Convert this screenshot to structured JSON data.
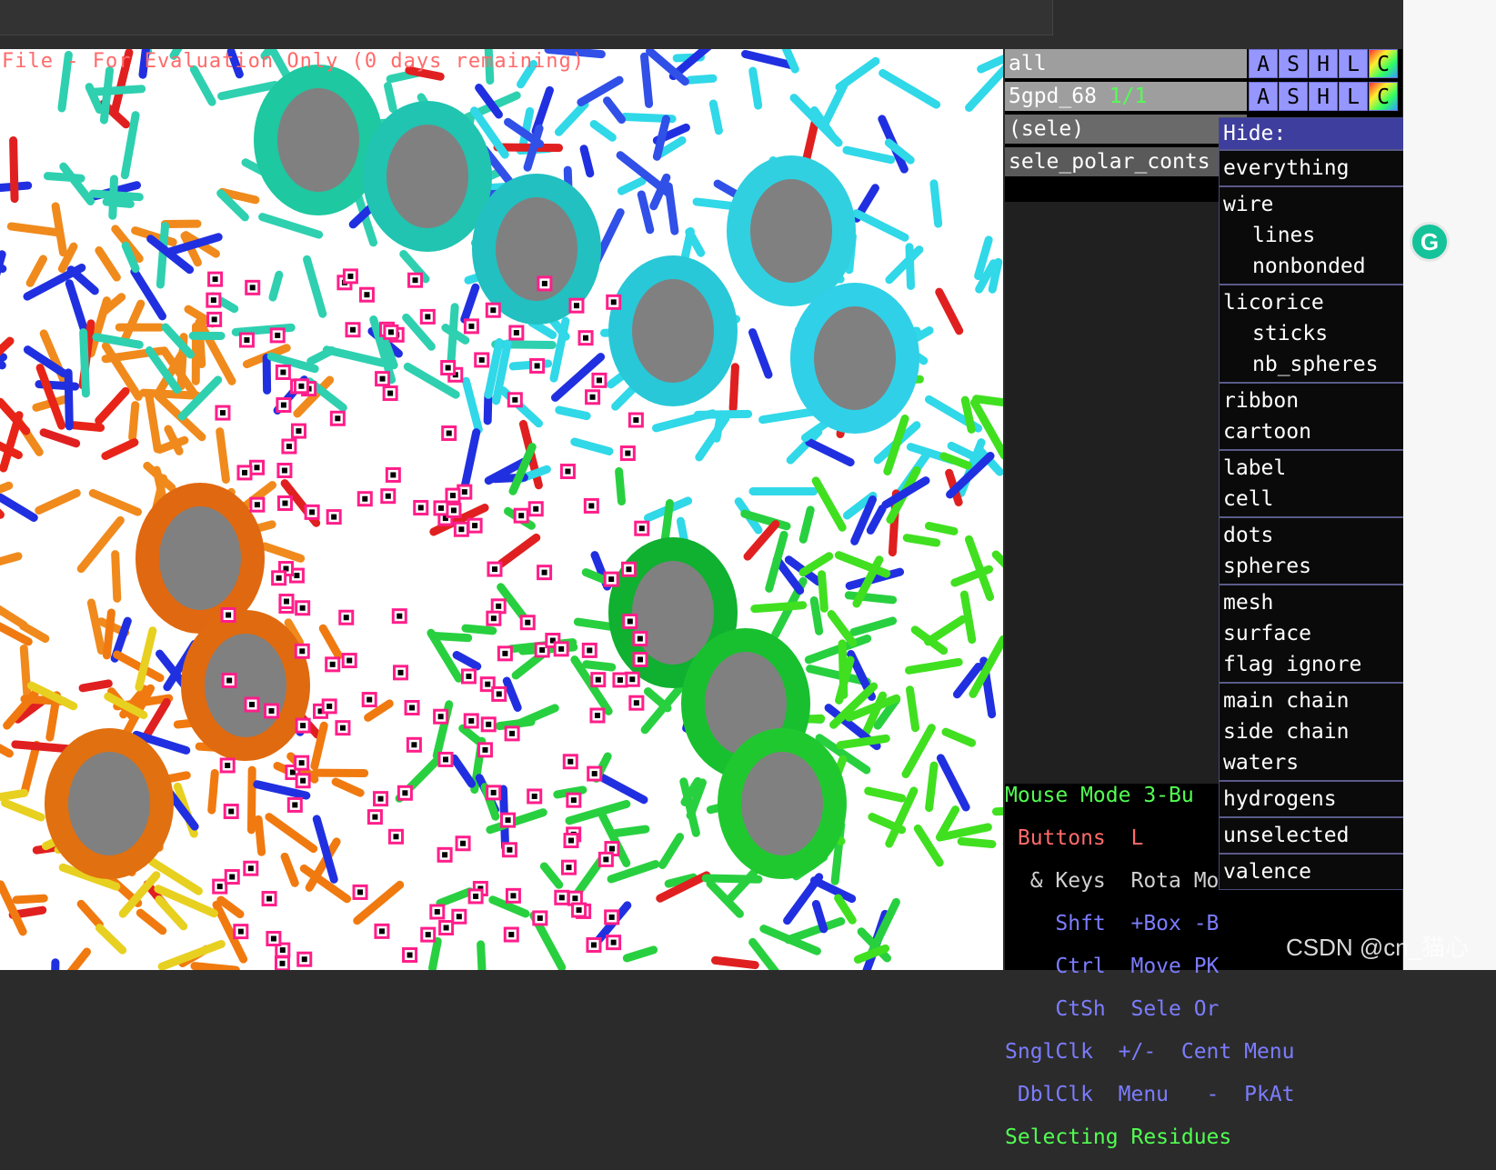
{
  "viewport": {
    "eval_notice": "File - For Evaluation Only (0 days remaining)"
  },
  "objects": [
    {
      "name": "all",
      "suffix": "",
      "buttons": [
        "A",
        "S",
        "H",
        "L",
        "C"
      ]
    },
    {
      "name": "5gpd_68",
      "suffix": "1/1",
      "buttons": [
        "A",
        "S",
        "H",
        "L",
        "C"
      ]
    }
  ],
  "selections": [
    "(sele)",
    "sele_polar_conts"
  ],
  "hide_menu": {
    "title": "Hide:",
    "groups": [
      [
        {
          "label": "everything",
          "indent": false
        }
      ],
      [
        {
          "label": "wire",
          "indent": false
        },
        {
          "label": "lines",
          "indent": true
        },
        {
          "label": "nonbonded",
          "indent": true
        }
      ],
      [
        {
          "label": "licorice",
          "indent": false
        },
        {
          "label": "sticks",
          "indent": true
        },
        {
          "label": "nb_spheres",
          "indent": true
        }
      ],
      [
        {
          "label": "ribbon",
          "indent": false
        },
        {
          "label": "cartoon",
          "indent": false
        }
      ],
      [
        {
          "label": "label",
          "indent": false
        },
        {
          "label": "cell",
          "indent": false
        }
      ],
      [
        {
          "label": "dots",
          "indent": false
        },
        {
          "label": "spheres",
          "indent": false
        }
      ],
      [
        {
          "label": "mesh",
          "indent": false
        },
        {
          "label": "surface",
          "indent": false
        },
        {
          "label": "flag ignore",
          "indent": false
        }
      ],
      [
        {
          "label": "main chain",
          "indent": false
        },
        {
          "label": "side chain",
          "indent": false
        },
        {
          "label": "waters",
          "indent": false
        }
      ],
      [
        {
          "label": "hydrogens",
          "indent": false
        }
      ],
      [
        {
          "label": "unselected",
          "indent": false
        }
      ],
      [
        {
          "label": "valence",
          "indent": false
        }
      ]
    ]
  },
  "mouse_help": {
    "mode_line": "Mouse Mode 3-Bu",
    "buttons_line": " Buttons  L",
    "keys_line": "  & Keys  Rota Mo",
    "shft_line": "    Shft  +Box -B",
    "ctrl_line": "    Ctrl  Move PK",
    "ctsh_line": "    CtSh  Sele Or",
    "sngl_line": "SnglClk  +/-  Cent Menu",
    "dbl_line": " DblClk  Menu   -  PkAt",
    "selecting_line": "Selecting Residues"
  },
  "watermark": "CSDN @cn_猫心",
  "grammarly_icon": "G"
}
